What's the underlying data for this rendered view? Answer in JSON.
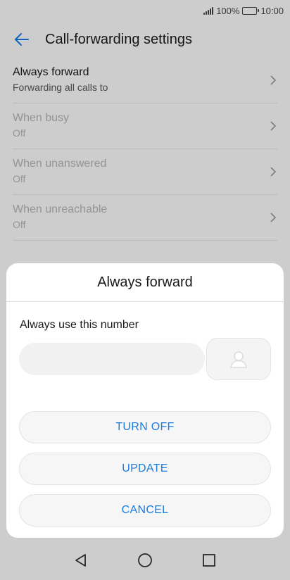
{
  "status_bar": {
    "battery_percent": "100%",
    "time": "10:00"
  },
  "app_bar": {
    "title": "Call-forwarding settings",
    "back_icon": "arrow-left-icon"
  },
  "list": {
    "items": [
      {
        "label": "Always forward",
        "sub": "Forwarding all calls to",
        "enabled": true
      },
      {
        "label": "When busy",
        "sub": "Off",
        "enabled": false
      },
      {
        "label": "When unanswered",
        "sub": "Off",
        "enabled": false
      },
      {
        "label": "When unreachable",
        "sub": "Off",
        "enabled": false
      }
    ]
  },
  "dialog": {
    "title": "Always forward",
    "field_label": "Always use this number",
    "number_value": "",
    "number_placeholder": "",
    "contact_icon": "contact-person-icon",
    "buttons": {
      "turn_off": "TURN OFF",
      "update": "UPDATE",
      "cancel": "CANCEL"
    }
  },
  "colors": {
    "accent": "#1a7be0",
    "disabled_text": "#b5b5b5"
  }
}
